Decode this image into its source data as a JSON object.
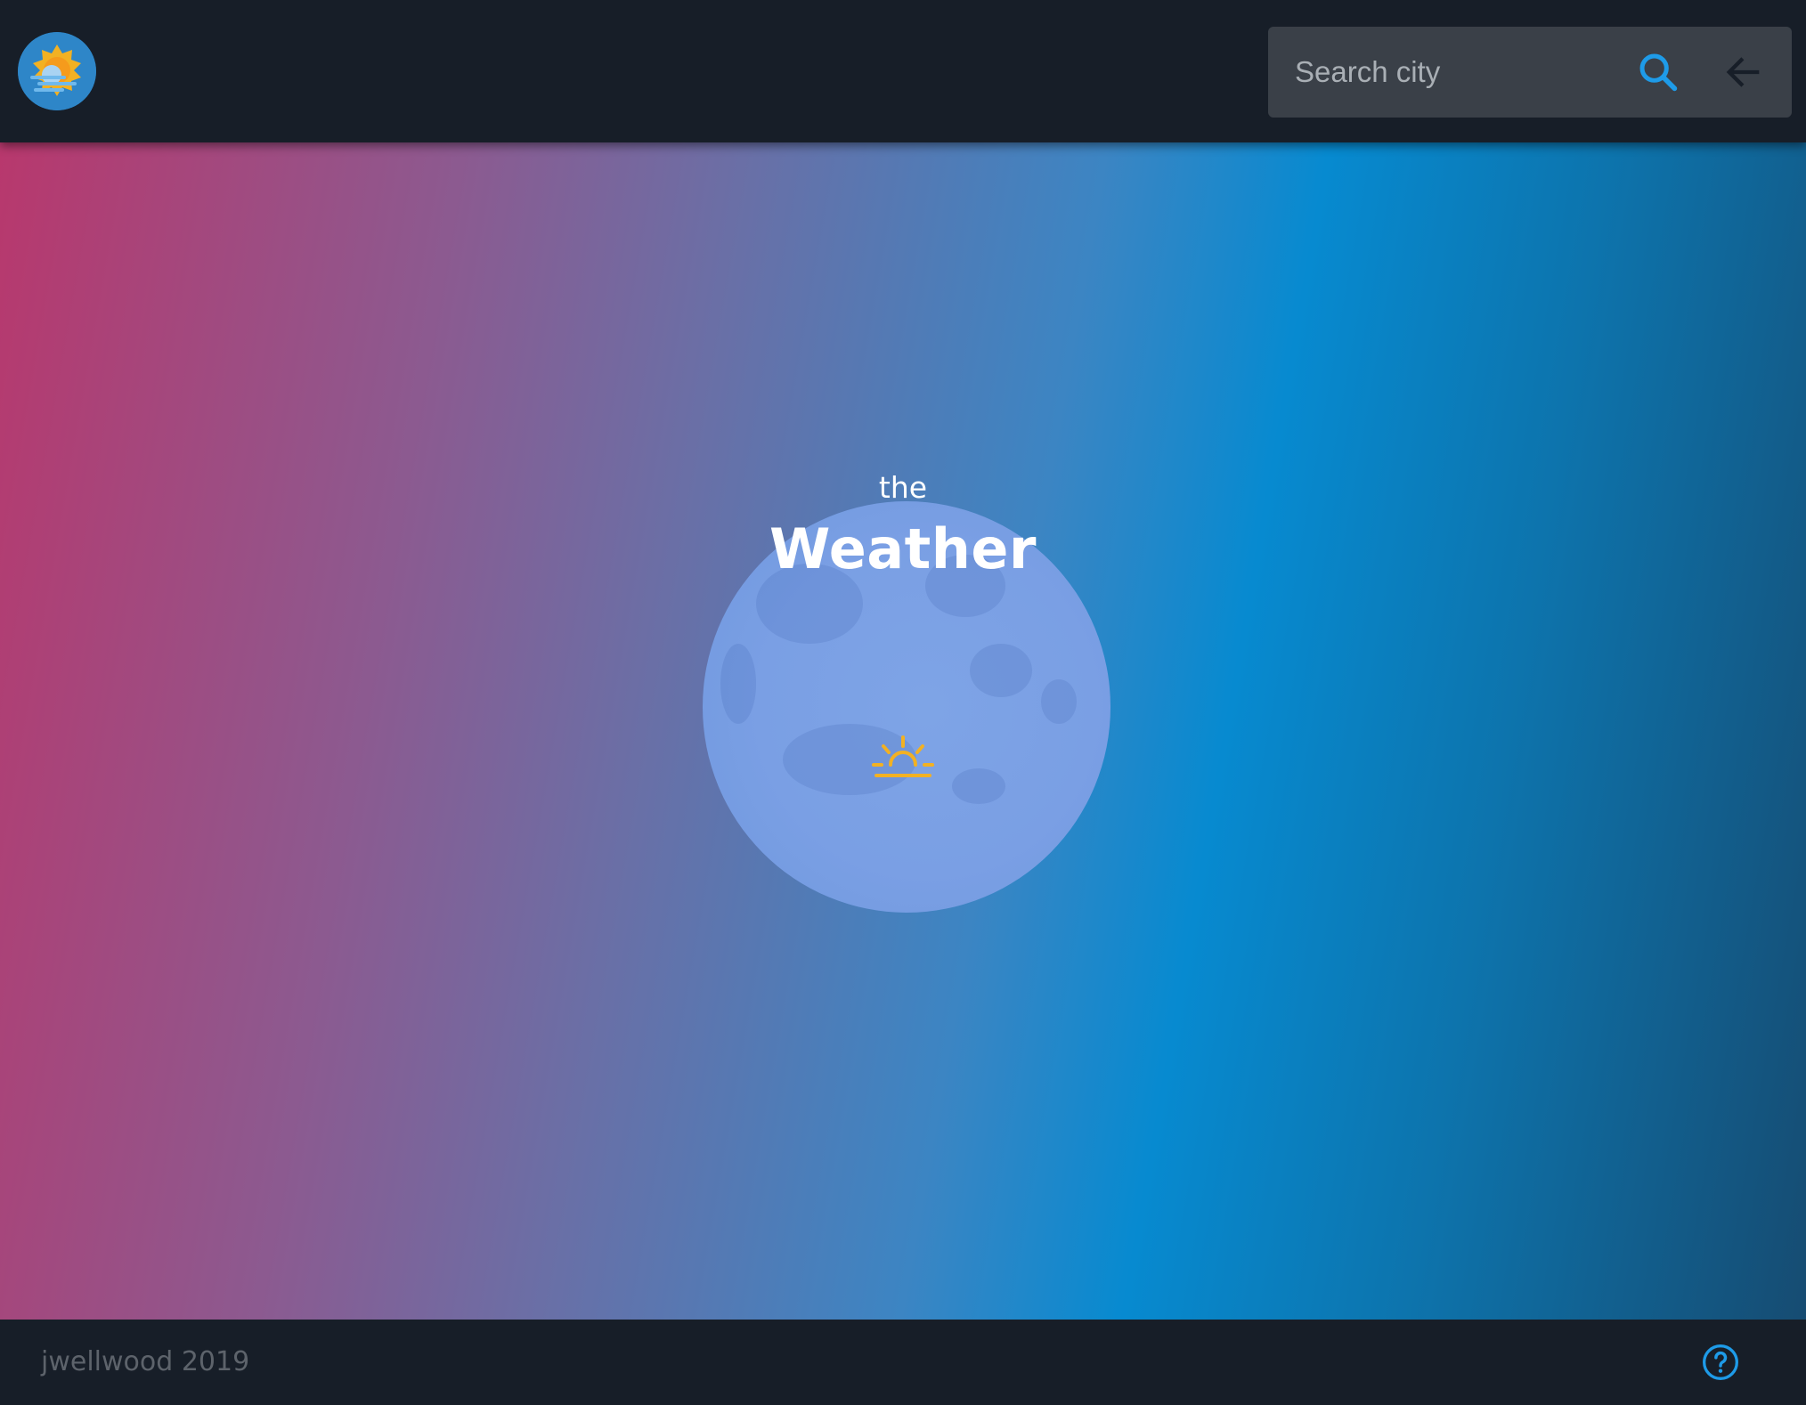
{
  "header": {
    "logo_icon": "weather-app-logo-icon",
    "search": {
      "placeholder": "Search city",
      "value": "",
      "search_icon": "search-icon",
      "back_icon": "arrow-left-icon"
    }
  },
  "hero": {
    "prefix": "the",
    "title": "Weather",
    "icon": "sunrise-icon"
  },
  "footer": {
    "credit": "jwellwood 2019",
    "help_icon": "help-circle-icon"
  },
  "colors": {
    "header_bg": "#171e28",
    "search_bg": "#3a4048",
    "accent": "#1e9be8",
    "sun": "#f2b123",
    "gradient_left": "#b8386d",
    "gradient_mid": "#078ad0",
    "gradient_right": "#164c72"
  }
}
